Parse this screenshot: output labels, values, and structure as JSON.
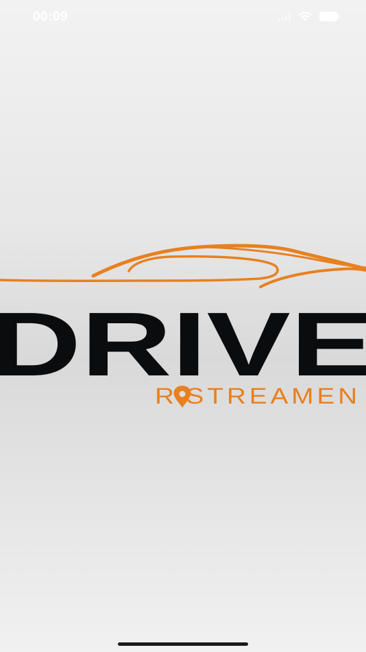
{
  "status_bar": {
    "time": "00:09",
    "icons": [
      "cellular-signal-icon",
      "wifi-icon",
      "battery-icon"
    ]
  },
  "splash": {
    "logo_word": "DRIVE",
    "logo_tagline": "R STREAMEN",
    "logo_icon": "car-outline-icon",
    "pin_icon": "location-pin-icon"
  },
  "colors": {
    "brand_orange": "#E8801F",
    "logo_black": "#0b0c0e",
    "status_text": "#ffffff"
  }
}
